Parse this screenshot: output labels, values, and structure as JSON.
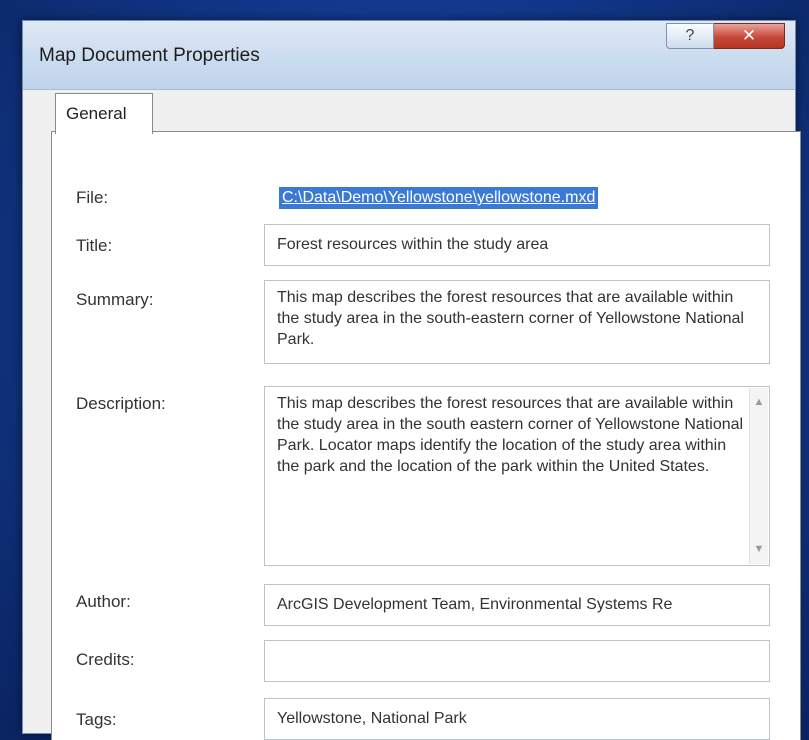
{
  "window": {
    "title": "Map Document Properties",
    "help_glyph": "?",
    "close_glyph": "✕"
  },
  "tabs": [
    {
      "label": "General"
    }
  ],
  "form": {
    "file": {
      "label": "File:",
      "value": "C:\\Data\\Demo\\Yellowstone\\yellowstone.mxd"
    },
    "title": {
      "label": "Title:",
      "value": "Forest resources within the study area"
    },
    "summary": {
      "label": "Summary:",
      "value": "This map describes the forest resources that are available within the study area in the south-eastern corner of Yellowstone National Park."
    },
    "description": {
      "label": "Description:",
      "value": "This map describes the forest resources that are available within the study area in the south eastern corner of Yellowstone National Park. Locator maps identify the location of the study area within the park and the location of the park within the United States."
    },
    "author": {
      "label": "Author:",
      "value": "ArcGIS Development Team, Environmental Systems Re"
    },
    "credits": {
      "label": "Credits:",
      "value": ""
    },
    "tags": {
      "label": "Tags:",
      "value": "Yellowstone, National Park"
    }
  },
  "scroll": {
    "up_glyph": "▲",
    "down_glyph": "▼"
  },
  "colors": {
    "background": "#123a8f",
    "selection": "#3a7ad6",
    "close_button": "#c7493a"
  }
}
